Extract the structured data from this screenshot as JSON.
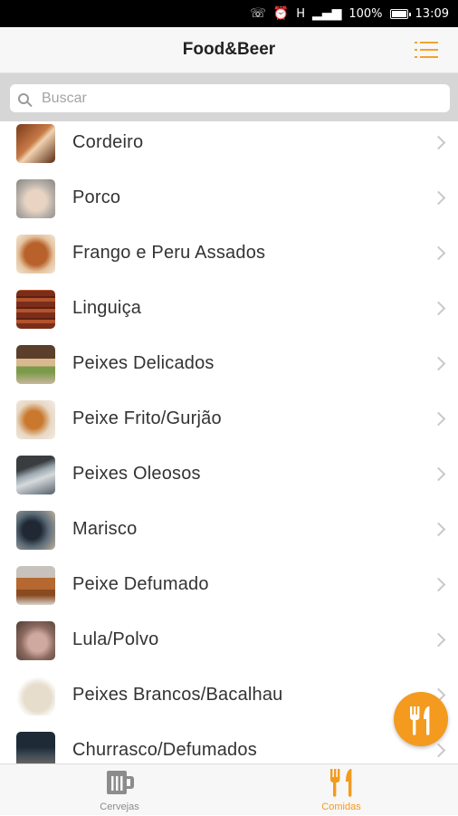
{
  "status_bar": {
    "battery": "100%",
    "time": "13:09",
    "network": "H"
  },
  "header": {
    "title": "Food&Beer"
  },
  "search": {
    "placeholder": "Buscar"
  },
  "items": [
    {
      "label": "Cordeiro"
    },
    {
      "label": "Porco"
    },
    {
      "label": "Frango e Peru Assados"
    },
    {
      "label": "Linguiça"
    },
    {
      "label": "Peixes Delicados"
    },
    {
      "label": "Peixe Frito/Gurjão"
    },
    {
      "label": "Peixes Oleosos"
    },
    {
      "label": "Marisco"
    },
    {
      "label": "Peixe Defumado"
    },
    {
      "label": "Lula/Polvo"
    },
    {
      "label": "Peixes Brancos/Bacalhau"
    },
    {
      "label": "Churrasco/Defumados"
    }
  ],
  "tabs": {
    "beers": "Cervejas",
    "foods": "Comidas",
    "active": "foods"
  },
  "colors": {
    "accent": "#f39a1f",
    "inactive": "#8c8c8c"
  }
}
